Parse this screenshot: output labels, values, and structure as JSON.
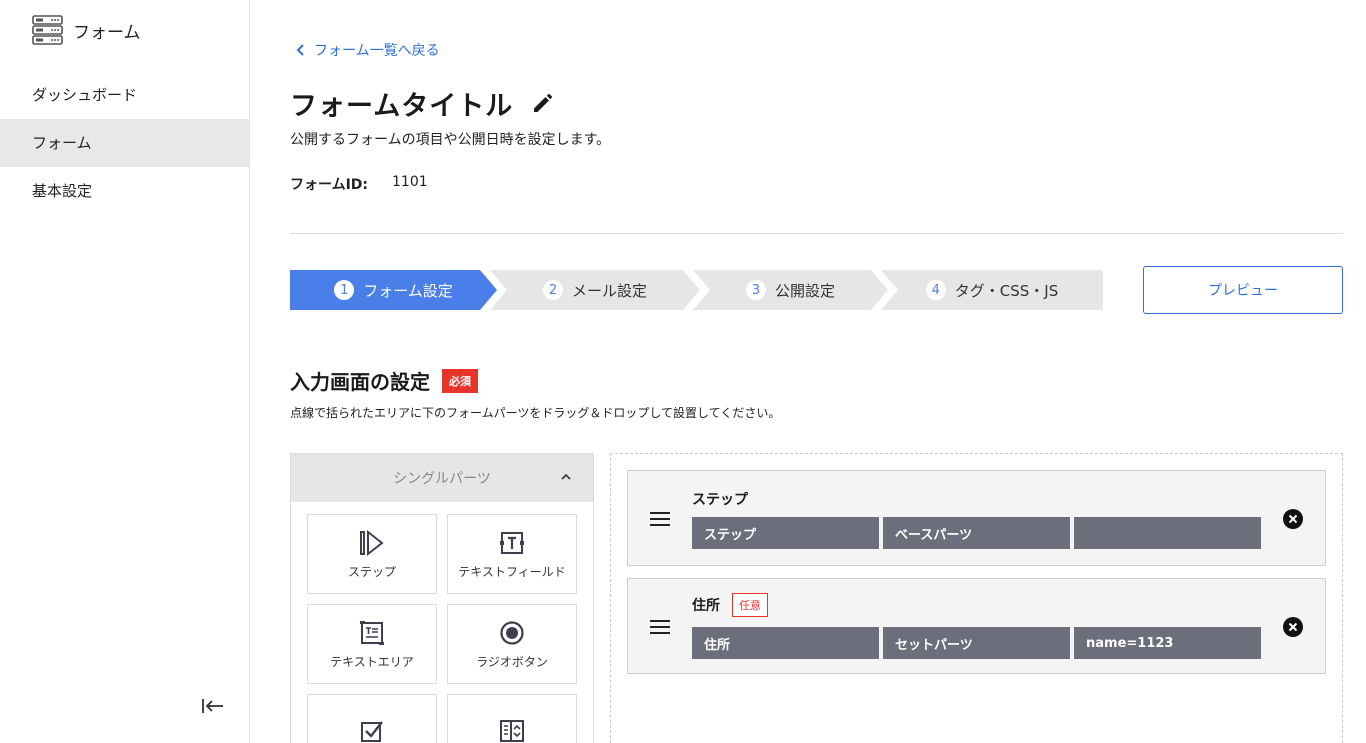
{
  "sidebar": {
    "brand_label": "フォーム",
    "items": [
      {
        "label": "ダッシュボード"
      },
      {
        "label": "フォーム"
      },
      {
        "label": "基本設定"
      }
    ]
  },
  "header": {
    "back_link": "フォーム一覧へ戻る",
    "title": "フォームタイトル",
    "description": "公開するフォームの項目や公開日時を設定します。",
    "form_id_label": "フォームID:",
    "form_id_value": "1101"
  },
  "stepper": {
    "steps": [
      {
        "num": "1",
        "label": "フォーム設定"
      },
      {
        "num": "2",
        "label": "メール設定"
      },
      {
        "num": "3",
        "label": "公開設定"
      },
      {
        "num": "4",
        "label": "タグ・CSS・JS"
      }
    ],
    "active_index": 0,
    "preview_label": "プレビュー"
  },
  "section": {
    "title": "入力画面の設定",
    "required_badge": "必須",
    "description": "点線で括られたエリアに下のフォームパーツをドラッグ＆ドロップして設置してください。"
  },
  "parts_panel": {
    "header": "シングルパーツ",
    "parts": [
      {
        "label": "ステップ",
        "icon": "step-icon"
      },
      {
        "label": "テキストフィールド",
        "icon": "text-field-icon"
      },
      {
        "label": "テキストエリア",
        "icon": "text-area-icon"
      },
      {
        "label": "ラジオボタン",
        "icon": "radio-button-icon"
      },
      {
        "label": "",
        "icon": "checkbox-icon"
      },
      {
        "label": "",
        "icon": "select-box-icon"
      }
    ]
  },
  "fields": [
    {
      "title": "ステップ",
      "badge": "",
      "chips": [
        "ステップ",
        "ベースパーツ",
        ""
      ]
    },
    {
      "title": "住所",
      "badge": "任意",
      "chips": [
        "住所",
        "セットパーツ",
        "name=1123"
      ]
    }
  ],
  "colors": {
    "accent": "#4a7ee8",
    "link": "#2f6fd6",
    "required": "#e8352c",
    "chip": "#6c6f7b",
    "step_inactive": "#e6e6e6"
  }
}
